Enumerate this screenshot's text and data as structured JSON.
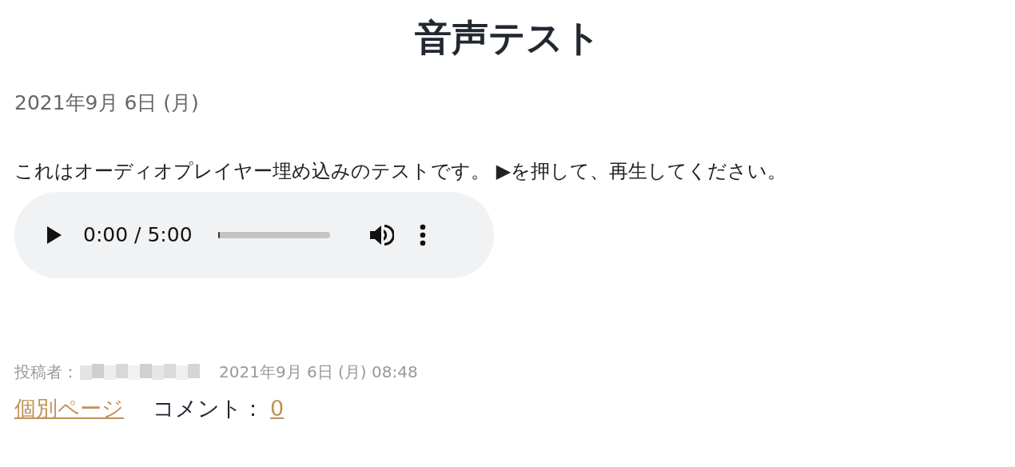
{
  "title": "音声テスト",
  "date": "2021年9月 6日 (月)",
  "body": "これはオーディオプレイヤー埋め込みのテストです。 ▶を押して、再生してください。",
  "player": {
    "time": "0:00 / 5:00",
    "progress": {
      "level": 0.01
    }
  },
  "meta": {
    "author_label": "投稿者：",
    "posted": "2021年9月 6日 (月) 08:48"
  },
  "links": {
    "permalink": "個別ページ",
    "comments_label": "コメント：",
    "comments_count": "0"
  }
}
